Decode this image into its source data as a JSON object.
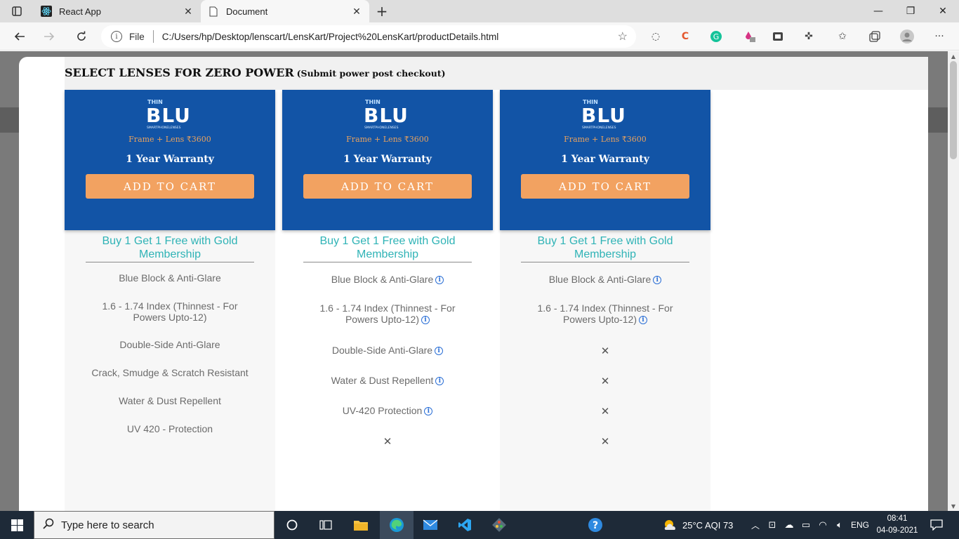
{
  "browser": {
    "tabs": [
      {
        "title": "React App",
        "favicon": "react-icon"
      },
      {
        "title": "Document",
        "favicon": "document-icon"
      }
    ],
    "tab_close": "✕",
    "new_tab": "+",
    "window_controls": {
      "minimize": "—",
      "maximize": "❐",
      "close": "✕"
    },
    "address": {
      "scheme_label": "File",
      "url": "C:/Users/hp/Desktop/lenscart/LensKart/Project%20LensKart/productDetails.html"
    }
  },
  "page": {
    "heading": "SELECT LENSES FOR ZERO POWER",
    "subheading": "(Submit power post checkout)",
    "products": [
      {
        "logo": {
          "top": "THIN",
          "main": "BLU",
          "bottom": "SMARTPHONELENSES"
        },
        "price": "Frame + Lens ₹3600",
        "warranty": "1 Year Warranty",
        "cta": "ADD TO CART",
        "promo": "Buy 1 Get 1 Free with Gold Membership",
        "features": [
          {
            "text": "Blue Block & Anti-Glare",
            "info": false,
            "available": true
          },
          {
            "text": "1.6 - 1.74 Index (Thinnest - For Powers Upto-12)",
            "info": false,
            "available": true
          },
          {
            "text": "Double-Side Anti-Glare",
            "info": false,
            "available": true
          },
          {
            "text": "Crack, Smudge & Scratch Resistant",
            "info": false,
            "available": true
          },
          {
            "text": "Water & Dust Repellent",
            "info": false,
            "available": true
          },
          {
            "text": "UV 420 - Protection",
            "info": false,
            "available": true
          }
        ]
      },
      {
        "logo": {
          "top": "THIN",
          "main": "BLU",
          "bottom": "SMARTPHONELENSES"
        },
        "price": "Frame + Lens ₹3600",
        "warranty": "1 Year Warranty",
        "cta": "ADD TO CART",
        "promo": "Buy 1 Get 1 Free with Gold Membership",
        "features": [
          {
            "text": "Blue Block & Anti-Glare",
            "info": true,
            "available": true
          },
          {
            "text": "1.6 - 1.74 Index (Thinnest - For Powers Upto-12)",
            "info": true,
            "available": true
          },
          {
            "text": "Double-Side Anti-Glare",
            "info": true,
            "available": true
          },
          {
            "text": "Water & Dust Repellent",
            "info": true,
            "available": true
          },
          {
            "text": "UV-420 Protection",
            "info": true,
            "available": true
          },
          {
            "text": "",
            "info": false,
            "available": false
          }
        ]
      },
      {
        "logo": {
          "top": "THIN",
          "main": "BLU",
          "bottom": "SMARTPHONELENSES"
        },
        "price": "Frame + Lens ₹3600",
        "warranty": "1 Year Warranty",
        "cta": "ADD TO CART",
        "promo": "Buy 1 Get 1 Free with Gold Membership",
        "features": [
          {
            "text": "Blue Block & Anti-Glare",
            "info": true,
            "available": true
          },
          {
            "text": "1.6 - 1.74 Index (Thinnest - For Powers Upto-12)",
            "info": true,
            "available": true
          },
          {
            "text": "",
            "info": false,
            "available": false
          },
          {
            "text": "",
            "info": false,
            "available": false
          },
          {
            "text": "",
            "info": false,
            "available": false
          },
          {
            "text": "",
            "info": false,
            "available": false
          }
        ]
      }
    ],
    "info_glyph": "i",
    "unavailable_glyph": "✕"
  },
  "taskbar": {
    "search_placeholder": "Type here to search",
    "weather": "25°C  AQI 73",
    "language": "ENG",
    "time": "08:41",
    "date": "04-09-2021"
  },
  "colors": {
    "card_blue": "#1254a6",
    "cta_orange": "#f2a261",
    "promo_teal": "#2fb3b6",
    "price_orange": "#e9a25e"
  }
}
